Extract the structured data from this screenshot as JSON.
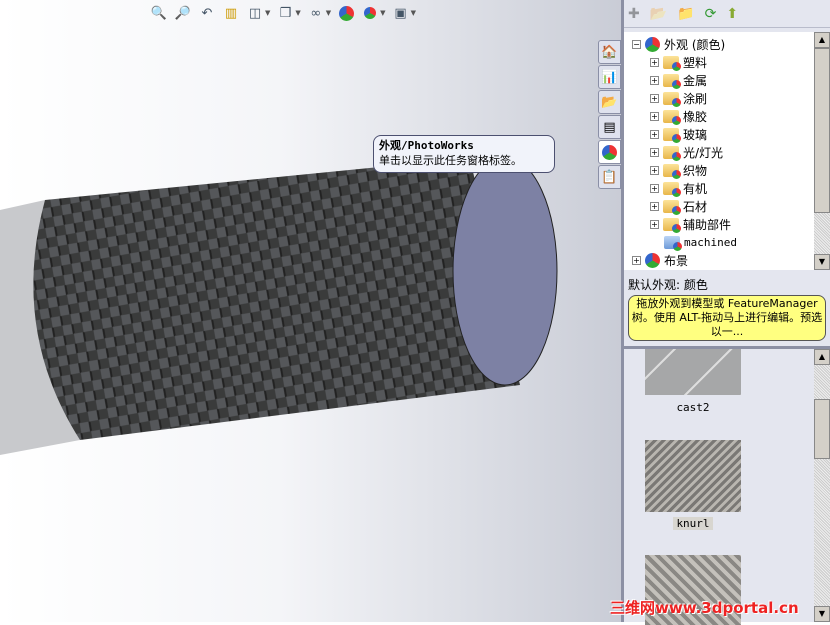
{
  "toolbar": {
    "icons": [
      "zoom-to-fit-icon",
      "zoom-area-icon",
      "previous-view-icon",
      "section-view-icon",
      "view-orientation-icon",
      "display-style-icon",
      "hide-show-icon",
      "appearance-icon",
      "scene-icon",
      "view-settings-icon"
    ]
  },
  "tooltip": {
    "title": "外观/PhotoWorks",
    "text": "单击以显示此任务窗格标签。"
  },
  "tabs": [
    "home-icon",
    "design-library-icon",
    "file-explorer-icon",
    "view-palette-icon",
    "appearance-icon",
    "custom-properties-icon"
  ],
  "tree": {
    "root": "外观 (颜色)",
    "children": [
      "塑料",
      "金属",
      "涂刷",
      "橡胶",
      "玻璃",
      "光/灯光",
      "织物",
      "有机",
      "石材",
      "辅助部件"
    ],
    "custom": "machined",
    "scene": "布景"
  },
  "description": {
    "title": "默认外观: 颜色",
    "hint": "拖放外观到模型或 FeatureManager 树。使用 ALT-拖动马上进行编辑。预选以一..."
  },
  "gallery": [
    {
      "label": "cast2"
    },
    {
      "label": "knurl"
    },
    {
      "label": ""
    }
  ],
  "watermark": "三维网www.3dportal.cn"
}
